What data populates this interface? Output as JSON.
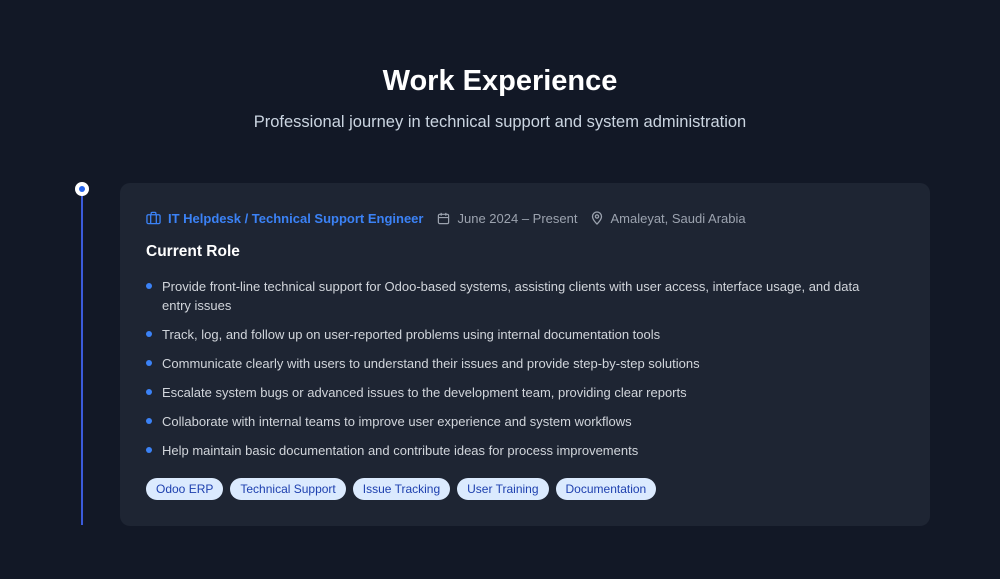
{
  "header": {
    "title": "Work Experience",
    "subtitle": "Professional journey in technical support and system administration"
  },
  "experience": {
    "job_title": "IT Helpdesk / Technical Support Engineer",
    "dates": "June 2024 – Present",
    "location": "Amaleyat, Saudi Arabia",
    "role_heading": "Current Role",
    "bullets": [
      "Provide front-line technical support for Odoo-based systems, assisting clients with user access, interface usage, and data entry issues",
      "Track, log, and follow up on user-reported problems using internal documentation tools",
      "Communicate clearly with users to understand their issues and provide step-by-step solutions",
      "Escalate system bugs or advanced issues to the development team, providing clear reports",
      "Collaborate with internal teams to improve user experience and system workflows",
      "Help maintain basic documentation and contribute ideas for process improvements"
    ],
    "tags": [
      "Odoo ERP",
      "Technical Support",
      "Issue Tracking",
      "User Training",
      "Documentation"
    ],
    "icons": {
      "job": "briefcase-icon",
      "dates": "calendar-icon",
      "location": "map-pin-icon"
    }
  },
  "colors": {
    "background": "#121826",
    "card": "#1e2533",
    "accent": "#3b82f6",
    "tag_bg": "#dbeafe",
    "tag_text": "#1e40af"
  }
}
